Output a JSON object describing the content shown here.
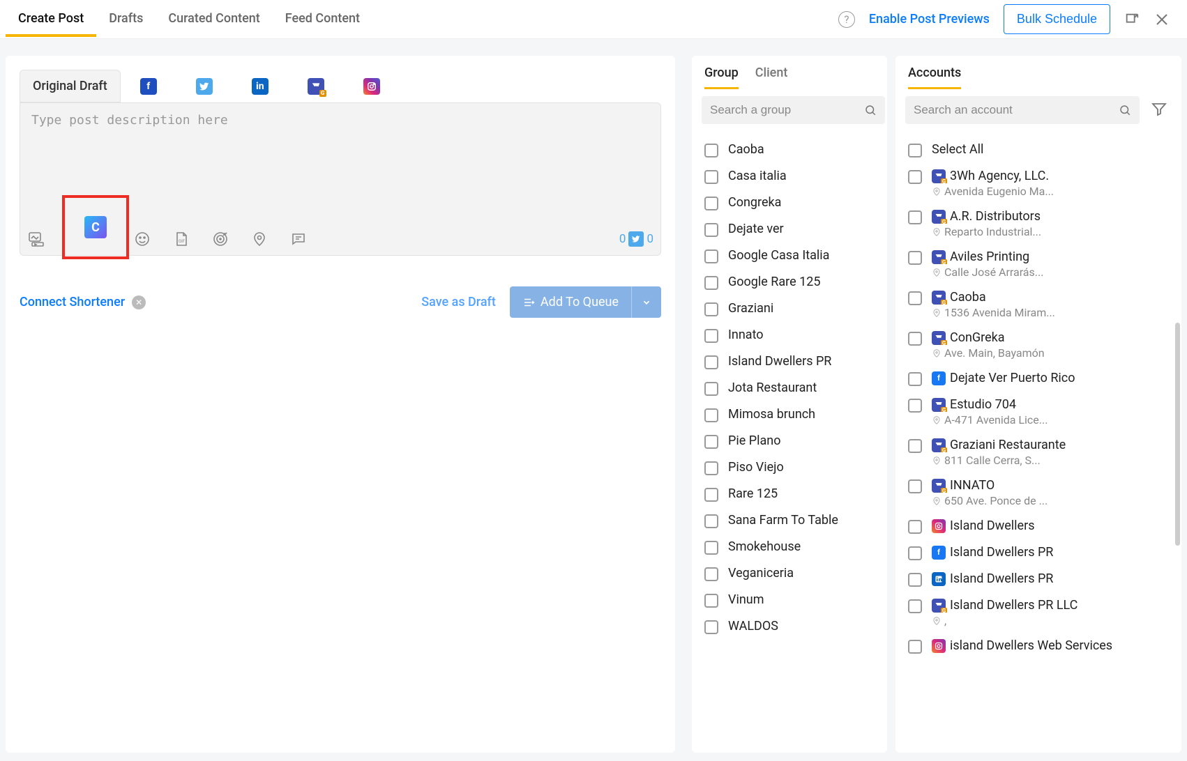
{
  "top_tabs": [
    "Create Post",
    "Drafts",
    "Curated Content",
    "Feed Content"
  ],
  "topbar": {
    "enable_previews": "Enable Post Previews",
    "bulk_schedule": "Bulk Schedule"
  },
  "editor": {
    "original_draft": "Original Draft",
    "placeholder": "Type post description here",
    "count1": "0",
    "count2": "0",
    "connect_shortener": "Connect Shortener",
    "save_draft": "Save as Draft",
    "add_queue": "Add To Queue"
  },
  "group_panel": {
    "tabs": [
      "Group",
      "Client"
    ],
    "search_placeholder": "Search a group",
    "items": [
      "Caoba",
      "Casa italia",
      "Congreka",
      "Dejate ver",
      "Google Casa Italia",
      "Google Rare 125",
      "Graziani",
      "Innato",
      "Island Dwellers PR",
      "Jota Restaurant",
      "Mimosa brunch",
      "Pie Plano",
      "Piso Viejo",
      "Rare 125",
      "Sana Farm To Table",
      "Smokehouse",
      "Veganiceria",
      "Vinum",
      "WALDOS"
    ]
  },
  "accounts_panel": {
    "tab": "Accounts",
    "search_placeholder": "Search an account",
    "select_all": "Select All",
    "items": [
      {
        "name": "3Wh Agency, LLC.",
        "sub": "Avenida Eugenio Ma...",
        "icon": "gmb"
      },
      {
        "name": "A.R. Distributors",
        "sub": "Reparto Industrial...",
        "icon": "gmb"
      },
      {
        "name": "Aviles Printing",
        "sub": "Calle José Arrarás...",
        "icon": "gmb"
      },
      {
        "name": "Caoba",
        "sub": "1536 Avenida Miram...",
        "icon": "gmb"
      },
      {
        "name": "ConGreka",
        "sub": "Ave. Main, Bayamón",
        "icon": "gmb"
      },
      {
        "name": "Dejate Ver Puerto Rico",
        "sub": "",
        "icon": "fb"
      },
      {
        "name": "Estudio 704",
        "sub": "A-471 Avenida Lice...",
        "icon": "gmb"
      },
      {
        "name": "Graziani Restaurante",
        "sub": "811 Calle Cerra, S...",
        "icon": "gmb"
      },
      {
        "name": "INNATO",
        "sub": "650 Ave. Ponce de ...",
        "icon": "gmb"
      },
      {
        "name": "Island Dwellers",
        "sub": "",
        "icon": "ig"
      },
      {
        "name": "Island Dwellers PR",
        "sub": "",
        "icon": "fb"
      },
      {
        "name": "Island Dwellers PR",
        "sub": "",
        "icon": "li"
      },
      {
        "name": "Island Dwellers PR LLC",
        "sub": ",",
        "icon": "gmb"
      },
      {
        "name": "island Dwellers Web Services",
        "sub": "",
        "icon": "ig"
      }
    ]
  }
}
